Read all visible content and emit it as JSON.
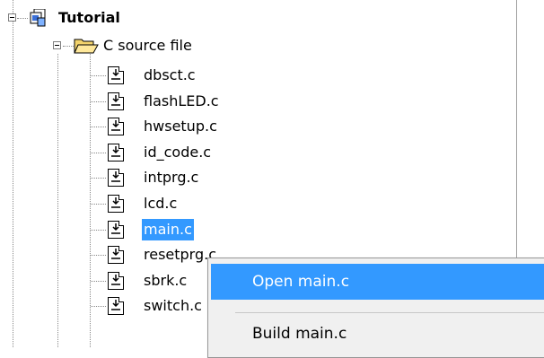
{
  "tree": {
    "project": {
      "label": "Tutorial",
      "icon": "project-icon"
    },
    "folder": {
      "label": "C source file",
      "icon": "folder-open-icon"
    },
    "files": [
      "dbsct.c",
      "flashLED.c",
      "hwsetup.c",
      "id_code.c",
      "intprg.c",
      "lcd.c",
      "main.c",
      "resetprg.c",
      "sbrk.c",
      "switch.c"
    ],
    "file_icon": "c-source-file-icon",
    "selected_file": "main.c"
  },
  "context_menu": {
    "items": [
      {
        "label": "Open main.c",
        "highlighted": true
      },
      {
        "label": "Build main.c",
        "highlighted": false
      }
    ]
  },
  "colors": {
    "selection": "#3399ff",
    "menu_bg": "#f0f0f0"
  }
}
